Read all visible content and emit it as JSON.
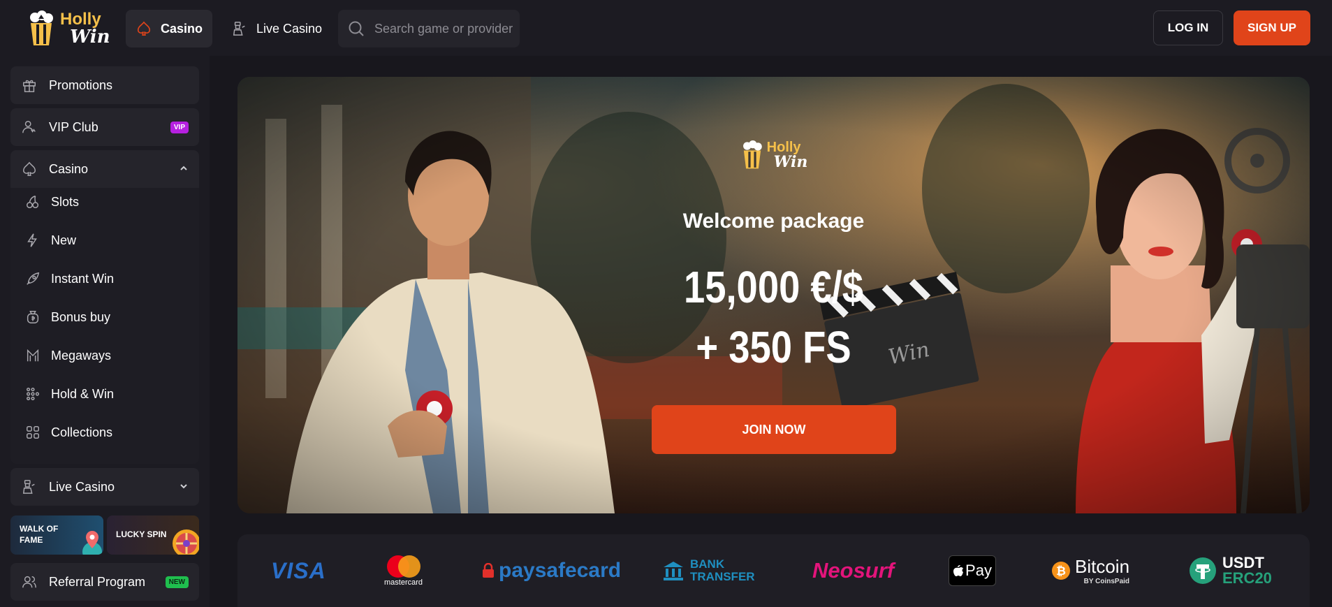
{
  "header": {
    "logo_line1": "Holly",
    "logo_line2": "Win",
    "tabs": [
      {
        "label": "Casino",
        "icon": "spade-icon",
        "active": true
      },
      {
        "label": "Live Casino",
        "icon": "dealer-icon",
        "active": false
      }
    ],
    "search": {
      "placeholder": "Search game or provider"
    },
    "login_label": "LOG IN",
    "signup_label": "SIGN UP",
    "accent_color": "#e0441a"
  },
  "sidebar": {
    "items": [
      {
        "label": "Promotions",
        "icon": "gift-icon"
      },
      {
        "label": "VIP Club",
        "icon": "vip-user-icon",
        "badge": "VIP"
      },
      {
        "label": "Casino",
        "icon": "spade-icon",
        "expanded": true
      },
      {
        "label": "Live Casino",
        "icon": "dealer-icon",
        "expanded": false
      },
      {
        "label": "Referral Program",
        "icon": "users-icon",
        "badge": "NEW"
      }
    ],
    "casino_sub": [
      {
        "label": "Slots",
        "icon": "cherries-icon"
      },
      {
        "label": "New",
        "icon": "lightning-icon"
      },
      {
        "label": "Instant Win",
        "icon": "rocket-icon"
      },
      {
        "label": "Bonus buy",
        "icon": "money-bag-icon"
      },
      {
        "label": "Megaways",
        "icon": "megaways-icon"
      },
      {
        "label": "Hold & Win",
        "icon": "dots-grid-icon"
      },
      {
        "label": "Collections",
        "icon": "grid-icon"
      }
    ],
    "promos": [
      {
        "label": "WALK OF FAME"
      },
      {
        "label": "LUCKY SPIN"
      }
    ]
  },
  "hero": {
    "logo_line1": "Holly",
    "logo_line2": "Win",
    "title": "Welcome package",
    "amount_line1": "15,000 €/$",
    "amount_line2": "+ 350 FS",
    "cta": "JOIN NOW"
  },
  "payments": [
    {
      "label": "VISA"
    },
    {
      "label": "mastercard"
    },
    {
      "label": "paysafecard"
    },
    {
      "label": "BANK TRANSFER"
    },
    {
      "label": "Neosurf"
    },
    {
      "label": "Pay"
    },
    {
      "label": "Bitcoin",
      "sub": "BY CoinsPaid"
    },
    {
      "label": "USDT",
      "sub": "ERC20"
    }
  ]
}
